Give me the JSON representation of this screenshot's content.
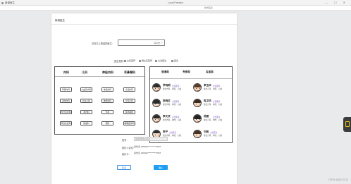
{
  "browser": {
    "tab_title": "新增医生",
    "window_title": "Local Preview",
    "controls": "— ☐ ✕"
  },
  "outer_labels": {
    "top": "新增医生",
    "section": "新增医生"
  },
  "page": {
    "title": "新增医生",
    "doctor_input_label": "请在左上角选择医生：",
    "doctor_input_value": "请点击 ▽",
    "type_label": "医生类别：",
    "type_options": [
      "主任医师",
      "副主任医师",
      "主治医生",
      "医生"
    ]
  },
  "departments": {
    "headers": [
      "内科",
      "儿科",
      "神经内科",
      "耳鼻喉科"
    ],
    "buttons": [
      [
        "呼吸内科",
        "心血管内科",
        "神经内科",
        "全部内科"
      ],
      [
        "消化内科",
        "新生儿科",
        "神经内科",
        "全部儿科"
      ],
      [
        "内分泌内科",
        "肾内科",
        "外科",
        "耳鼻喉科"
      ],
      [
        "风湿免疫科",
        "肿瘤科",
        "眼科",
        "睡眠医学科"
      ]
    ]
  },
  "doctors": {
    "headers": [
      "普通类",
      "专家类",
      "名医类"
    ],
    "list": [
      {
        "name": "罗晓明",
        "tag": "主任医师",
        "desc": "擅长内科、呼吸、心脏"
      },
      {
        "name": "李玉华",
        "tag": "主任医师",
        "desc": "擅长儿科、呼吸、心脏"
      },
      {
        "name": "张晓红",
        "tag": "主任医师",
        "desc": "擅长内科、神经、心脏"
      },
      {
        "name": "程卫华",
        "tag": "主任医师",
        "desc": "擅长儿科、神经、心脏"
      },
      {
        "name": "李文庆",
        "tag": "主治医师",
        "desc": "擅长内科、神经、心脏"
      },
      {
        "name": "杨丽",
        "tag": "主治医生",
        "desc": "擅长儿科、神经、心脏"
      },
      {
        "name": "李宁",
        "tag": "主治医生",
        "desc": "擅长内科、神经、心脏"
      },
      {
        "name": "刘笑",
        "tag": "主治医生",
        "desc": "擅长儿科、神经、心脏"
      }
    ]
  },
  "form": {
    "fee_label": "挂号：",
    "fee_value": "请选择医生后显示",
    "id_label": "就诊人证件：",
    "id_value": "身份证 230402**********4567",
    "card_label": "就诊卡：",
    "card_value": "身份证 230402**********4567"
  },
  "buttons": {
    "cancel": "取消",
    "confirm": "确认"
  },
  "watermark": "CSDN @成人达己"
}
